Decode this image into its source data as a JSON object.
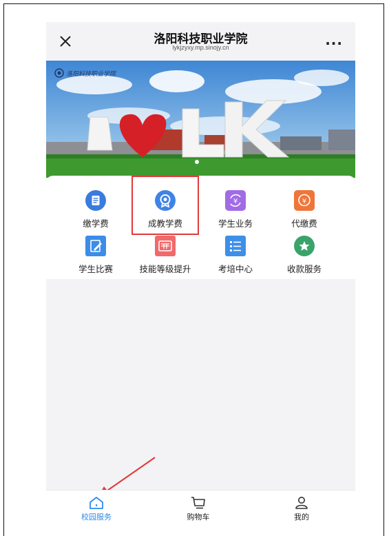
{
  "header": {
    "close_icon": "close-icon",
    "title": "洛阳科技职业学院",
    "subtitle": "lykjzyxy.mp.sinojy.cn",
    "more_label": "..."
  },
  "banner": {
    "image": "campus-photo-i-love-k-sculpture",
    "carousel_active_index": 0
  },
  "services": [
    {
      "label": "缴学费",
      "icon": "receipt-icon",
      "color": "#3a7bdf"
    },
    {
      "label": "成教学费",
      "icon": "badge-icon",
      "color": "#3f83e6",
      "highlighted": true
    },
    {
      "label": "学生业务",
      "icon": "yuan-exchange-icon",
      "color": "#a26be6"
    },
    {
      "label": "代缴费",
      "icon": "yuan-coin-icon",
      "color": "#f0753a"
    },
    {
      "label": "学生比赛",
      "icon": "edit-icon",
      "color": "#3b8de8"
    },
    {
      "label": "技能等级提升",
      "icon": "certificate-icon",
      "color": "#f06a6a"
    },
    {
      "label": "考培中心",
      "icon": "list-icon",
      "color": "#3d8fe8"
    },
    {
      "label": "收款服务",
      "icon": "star-icon",
      "color": "#3aa36a"
    }
  ],
  "tabbar": {
    "items": [
      {
        "label": "校园服务",
        "icon": "home-icon",
        "active": true
      },
      {
        "label": "购物车",
        "icon": "cart-icon",
        "active": false
      },
      {
        "label": "我的",
        "icon": "user-icon",
        "active": false
      }
    ],
    "active_color": "#2e8bea"
  }
}
